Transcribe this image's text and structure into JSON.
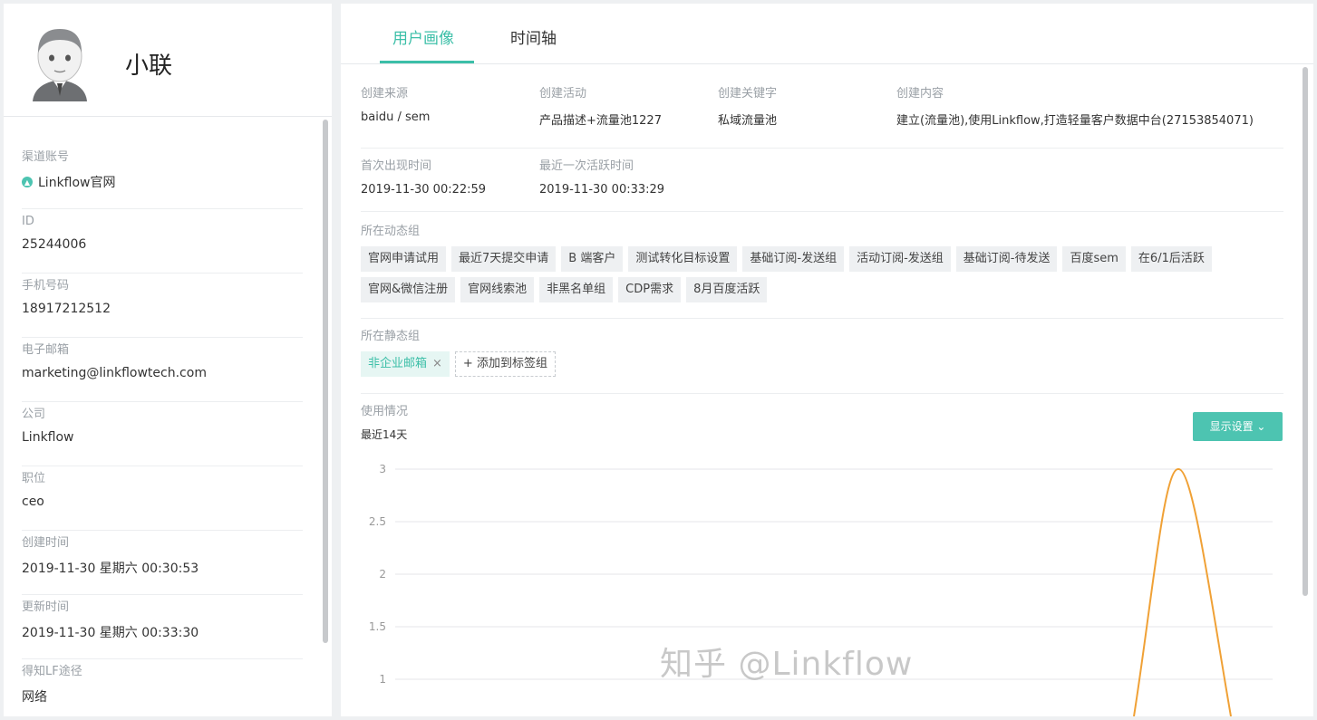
{
  "profile": {
    "name": "小联"
  },
  "fields": [
    {
      "label": "渠道账号",
      "value": "Linkflow官网",
      "icon": "channel-icon"
    },
    {
      "label": "ID",
      "value": "25244006"
    },
    {
      "label": "手机号码",
      "value": "18917212512"
    },
    {
      "label": "电子邮箱",
      "value": "marketing@linkflowtech.com"
    },
    {
      "label": "公司",
      "value": "Linkflow"
    },
    {
      "label": "职位",
      "value": "ceo"
    },
    {
      "label": "创建时间",
      "value": "2019-11-30 星期六 00:30:53"
    },
    {
      "label": "更新时间",
      "value": "2019-11-30 星期六 00:33:30"
    },
    {
      "label": "得知LF途径",
      "value": "网络"
    }
  ],
  "tabs": [
    {
      "label": "用户画像",
      "active": true
    },
    {
      "label": "时间轴",
      "active": false
    }
  ],
  "info": {
    "row1": [
      {
        "label": "创建来源",
        "value": "baidu / sem"
      },
      {
        "label": "创建活动",
        "value": "产品描述+流量池1227"
      },
      {
        "label": "创建关键字",
        "value": "私域流量池"
      },
      {
        "label": "创建内容",
        "value": "建立(流量池),使用Linkflow,打造轻量客户数据中台(27153854071)"
      }
    ],
    "row2": [
      {
        "label": "首次出现时间",
        "value": "2019-11-30 00:22:59"
      },
      {
        "label": "最近一次活跃时间",
        "value": "2019-11-30 00:33:29"
      }
    ]
  },
  "dynamic_groups": {
    "label": "所在动态组",
    "tags": [
      "官网申请试用",
      "最近7天提交申请",
      "B 端客户",
      "测试转化目标设置",
      "基础订阅-发送组",
      "活动订阅-发送组",
      "基础订阅-待发送",
      "百度sem",
      "在6/1后活跃",
      "官网&微信注册",
      "官网线索池",
      "非黑名单组",
      "CDP需求",
      "8月百度活跃"
    ]
  },
  "static_groups": {
    "label": "所在静态组",
    "tag": "非企业邮箱",
    "close_symbol": "×",
    "add_label": "+ 添加到标签组"
  },
  "usage": {
    "label": "使用情况",
    "subtitle": "最近14天",
    "button_label": "显示设置 ⌄"
  },
  "chart_data": {
    "type": "line",
    "y_ticks": [
      3,
      2.5,
      2,
      1.5,
      1
    ],
    "ylim": [
      1,
      3
    ],
    "series": [
      {
        "color": "#f0a136",
        "peak": 3
      }
    ]
  },
  "watermark": "知乎 @Linkflow"
}
